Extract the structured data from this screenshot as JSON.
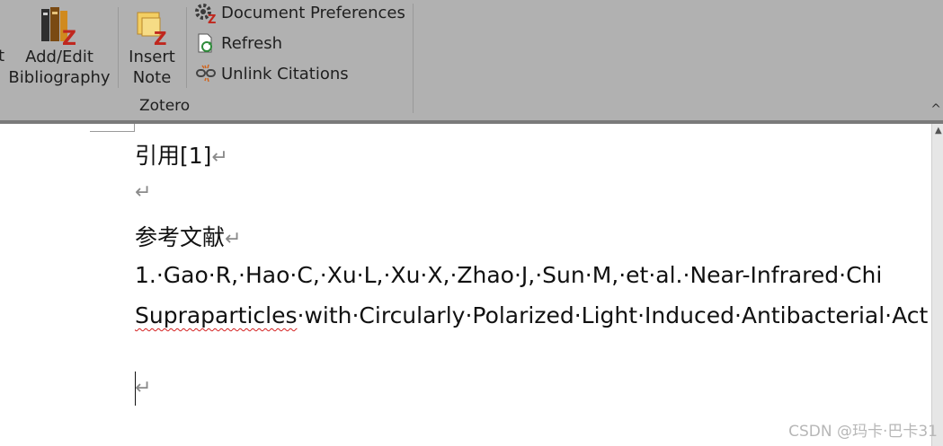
{
  "ribbon": {
    "cut_label": "t",
    "add_edit_label_1": "Add/Edit",
    "add_edit_label_2": "Bibliography",
    "insert_note_label_1": "Insert",
    "insert_note_label_2": "Note",
    "document_preferences_label": "Document Preferences",
    "refresh_label": "Refresh",
    "unlink_citations_label": "Unlink Citations",
    "group_label": "Zotero",
    "collapse_glyph": "^"
  },
  "document": {
    "citation_line": "引用[1]",
    "paragraph_mark": "↵",
    "references_heading": "参考文献",
    "reference_line_1": "1.·Gao·R,·Hao·C,·Xu·L,·Xu·X,·Zhao·J,·Sun·M,·et·al.·Near-Infrared·Chi",
    "reference_line_2_misspelled": "Supraparticles",
    "reference_line_2_rest": "·with·Circularly·Polarized·Light·Induced·Antibacterial·Act"
  },
  "watermark": "CSDN @玛卡·巴卡31"
}
